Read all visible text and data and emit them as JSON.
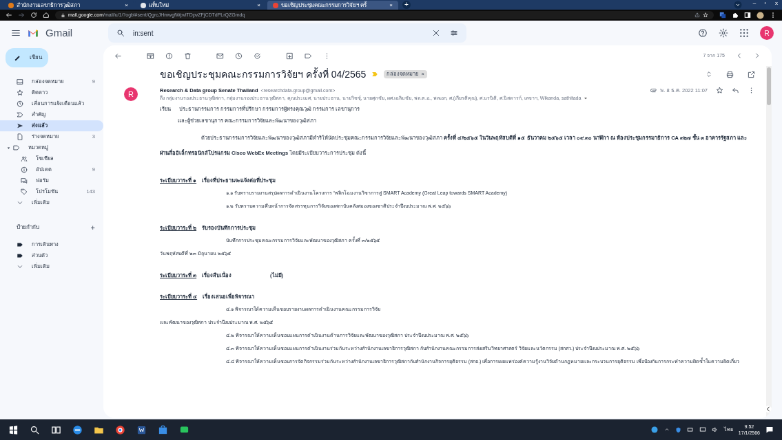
{
  "browser": {
    "tabs": [
      {
        "title": "สำนักงานเลขาธิการวุฒิสภา",
        "close": "×",
        "selected": false
      },
      {
        "title": "แท็บใหม่",
        "close": "×",
        "selected": false
      },
      {
        "title": "ขอเชิญประชุมคณะกรรมการวิจัยฯ ครั้",
        "close": "×",
        "selected": true
      }
    ],
    "new_tab": "+",
    "url_host": "mail.google.com",
    "url_path": "/mail/u/1/?ogbl#sent/QgrcJHmwgfWpvlTDpvZFjCDTdPLrQZGmdq",
    "window_controls": [
      "–",
      "▫",
      "x"
    ]
  },
  "header": {
    "app_name": "Gmail",
    "search_value": "in:sent",
    "avatar": "R"
  },
  "sidebar": {
    "compose": "เขียน",
    "items": [
      {
        "label": "กล่องจดหมาย",
        "count": "9",
        "selected": false
      },
      {
        "label": "ติดดาว",
        "selected": false
      },
      {
        "label": "เลื่อนการแจ้งเตือนแล้ว",
        "selected": false
      },
      {
        "label": "สำคัญ",
        "selected": false
      },
      {
        "label": "ส่งแล้ว",
        "selected": true
      },
      {
        "label": "ร่างจดหมาย",
        "count": "3",
        "selected": false
      },
      {
        "label": "หมวดหมู่",
        "selected": false,
        "expanded": true,
        "children": [
          {
            "label": "โซเชียล",
            "selected": false
          },
          {
            "label": "อัปเดต",
            "count": "9",
            "selected": false
          },
          {
            "label": "ฟอรัม",
            "selected": false
          },
          {
            "label": "โปรโมชัน",
            "count": "143",
            "selected": false
          }
        ]
      },
      {
        "label": "เพิ่มเติม",
        "selected": false
      }
    ],
    "labels_title": "ป้ายกำกับ",
    "labels_add": "+",
    "labels": [
      {
        "label": "การเดินทาง"
      },
      {
        "label": "ส่วนตัว"
      }
    ],
    "labels_more": "เพิ่มเติม"
  },
  "toolbar": {
    "position": "7 จาก 175"
  },
  "message": {
    "subject": "ขอเชิญประชุมคณะกรรมการวิจัยฯ ครั้งที่ 04/2565",
    "label_chip": "กล่องจดหมาย",
    "label_chip_close": "×",
    "avatar": "R",
    "sender_name": "Research & Data group Senate Thailand",
    "sender_email": "<researchdata.group@gmail.com>",
    "recipients": "ถึง กลุ่มงานรองประธานวุฒิสภา, กลุ่มงานรองประธานวุฒิสภา, คุณประเมศ, นายประธาน, นายวิชชุ์, นายศุภชัย, ผศ.เฉลิมชัย, พล.ต.อ., พลเอก, ศ.(เกียรติคุณ), ศ.นรนิติ, ศ.นิสดารก์, เลขาฯ, Wikanda, sathitada",
    "date": "พ. 8 ธ.ค. 2022 11:07",
    "salutation_label": "เรียน",
    "salutation": "ประธานกรรมการ กรรมการที่ปรึกษา กรรมการผู้ทรงคุณวุฒิ กรรมการ เลขานุการ",
    "salutation_cont": "และผู้ช่วยเลขานุการ คณะกรรมการวิจัยและพัฒนาของวุฒิสภา",
    "intro": "ด้วยประธานกรรมการวิจัยและพัฒนาของวุฒิสภามีดำริให้นัดประชุมคณะกรรมการวิจัยและพัฒนาของวุฒิสภา **ครั้งที่ ๔/๒๕๖๕ ในวันพฤหัสบดีที่ ๑๕ ธันวาคม ๒๕๖๕ เวลา ๐๙.๓๐ นาฬิกา ณ ห้องประชุมกรรมาธิการ CA ๓๒๗ ชั้น ๓ อาคารรัฐสภา และผ่านสื่ออิเล็กทรอนิกส์โปรแกรม Cisco WebEx Meetings** โดยมีระเบียบวาระการประชุม ดังนี้",
    "agenda": [
      {
        "heading": "ระเบียบวาระที่ ๑",
        "title": "เรื่องที่ประธานจะแจ้งต่อที่ประชุม",
        "lines": [
          {
            "text": "๑.๑ รับทราบรายงานสรุปผลการดำเนินงานโครงการ “พลิกโฉมงานวิชาการสู่ SMART Academy (Great Leap towards SMART Academy)",
            "kind": "item"
          },
          {
            "text": "๑.๒ รับทราบความคืบหน้าการจัดสรรทุนการวิจัยของสถาบันคลังสมองของชาติประจำปีงบประมาณ พ.ศ. ๒๕๖๖",
            "kind": "item"
          }
        ]
      },
      {
        "heading": "ระเบียบวาระที่ ๒",
        "title": "รับรองบันทึกการประชุม",
        "lines": [
          {
            "text": "บันทึกการประชุมคณะกรรมการวิจัยและพัฒนาของวุฒิสภา ครั้งที่ ๓/๒๕๖๕",
            "kind": "item"
          },
          {
            "text": "วันพฤหัสบดีที่ ๒๓ มิถุนายน ๒๕๖๕",
            "kind": "continuation"
          }
        ]
      },
      {
        "heading": "ระเบียบวาระที่ ๓",
        "title": "เรื่องสืบเนื่อง",
        "note": "(ไม่มี)"
      },
      {
        "heading": "ระเบียบวาระที่ ๔",
        "title": "เรื่องเสนอเพื่อพิจารณา",
        "lines": [
          {
            "text": "๔.๑ พิจารณาให้ความเห็นชอบรายงานผลการดำเนินงานคณะกรรมการวิจัย",
            "kind": "item"
          },
          {
            "text": "และพัฒนาของวุฒิสภา ประจำปีงบประมาณ พ.ศ. ๒๕๖๕",
            "kind": "continuation"
          },
          {
            "text": "๔.๒ พิจารณาให้ความเห็นชอบแผนการดำเนินงานด้านการวิจัยและพัฒนาของวุฒิสภา ประจำปีงบประมาณ พ.ศ. ๒๕๖๖",
            "kind": "item"
          },
          {
            "text": "๔.๓ พิจารณาให้ความเห็นชอบแผนการดำเนินงานร่วมกันระหว่างสำนักงานเลขาธิการวุฒิสภา กับสำนักงานคณะกรรมการส่งเสริมวิทยาศาสตร์ วิจัยและนวัตกรรม (สกสว.) ประจำปีงบประมาณ พ.ศ. ๒๕๖๖",
            "kind": "item"
          },
          {
            "text": "๔.๔ พิจารณาให้ความเห็นชอบการจัดกิจกรรมร่วมกันระหว่างสำนักงานเลขาธิการวุฒิสภากับสำนักงานกิจการยุติธรรม (สกธ.) เพื่อการเผยแพร่องค์ความรู้งานวิจัยด้านกฎหมายและกระบวนการยุติธรรม เพื่อป้องกันการกระทำความผิดซ้ำในความผิดเกี่ยว",
            "kind": "item"
          }
        ]
      }
    ]
  },
  "taskbar": {
    "time": "9:52",
    "date": "17/1/2566",
    "lang": "ไทย"
  }
}
